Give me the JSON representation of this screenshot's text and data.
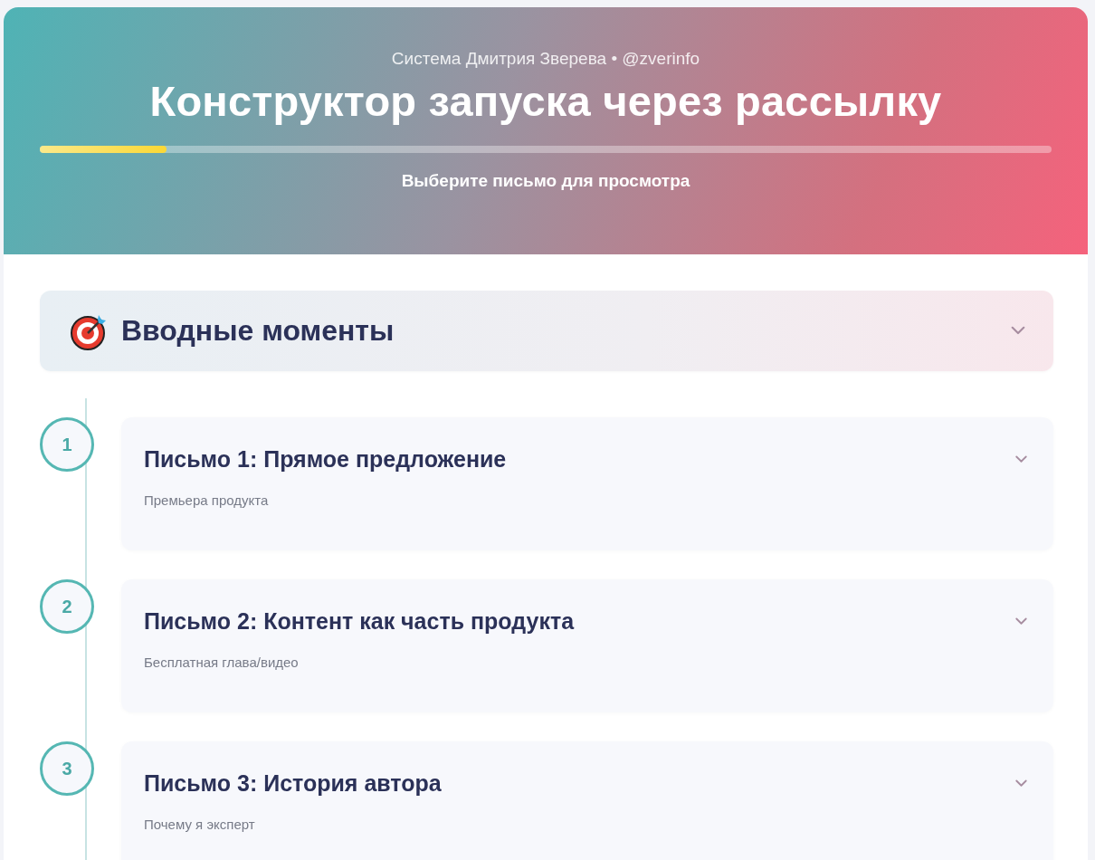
{
  "header": {
    "subtitle": "Система Дмитрия Зверева • @zverinfo",
    "title": "Конструктор запуска через рассылку",
    "progress": {
      "level": 0.125
    },
    "hint": "Выберите письмо для просмотра"
  },
  "section": {
    "title": "Вводные моменты",
    "expanded": false,
    "letters": [
      {
        "number": "1",
        "title": "Письмо 1: Прямое предложение",
        "subtitle": "Премьера продукта",
        "expanded": false
      },
      {
        "number": "2",
        "title": "Письмо 2: Контент как часть продукта",
        "subtitle": "Бесплатная глава/видео",
        "expanded": false
      },
      {
        "number": "3",
        "title": "Письмо 3: История автора",
        "subtitle": "Почему я эксперт",
        "expanded": false
      }
    ]
  }
}
